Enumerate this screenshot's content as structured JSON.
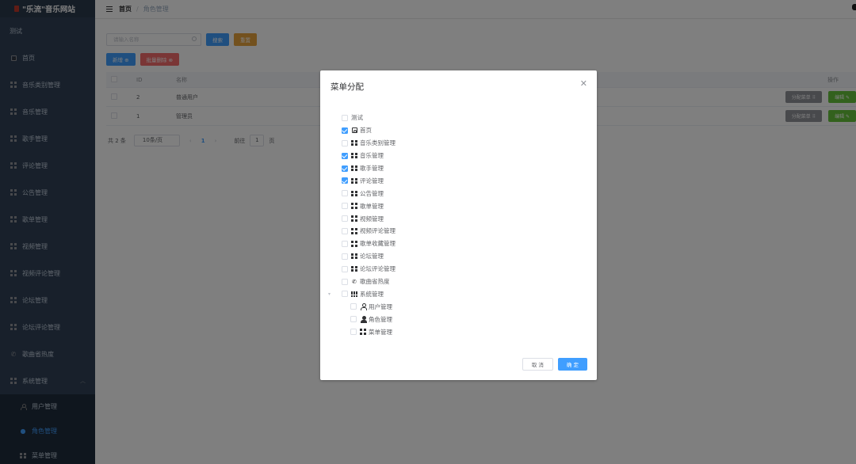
{
  "app": {
    "logo_text": "\"乐流\"音乐网站"
  },
  "sidebar": {
    "items": [
      {
        "label": "测试",
        "icon": "none"
      },
      {
        "label": "首页",
        "icon": "home-icon"
      },
      {
        "label": "音乐类别管理",
        "icon": "grid-icon"
      },
      {
        "label": "音乐管理",
        "icon": "grid-icon"
      },
      {
        "label": "歌手管理",
        "icon": "grid-icon"
      },
      {
        "label": "评论管理",
        "icon": "grid-icon"
      },
      {
        "label": "公告管理",
        "icon": "grid-icon"
      },
      {
        "label": "歌单管理",
        "icon": "grid-icon"
      },
      {
        "label": "视频管理",
        "icon": "grid-icon"
      },
      {
        "label": "视频评论管理",
        "icon": "grid-icon"
      },
      {
        "label": "论坛管理",
        "icon": "grid-icon"
      },
      {
        "label": "论坛评论管理",
        "icon": "grid-icon"
      },
      {
        "label": "歌曲省热度",
        "icon": "phone-icon"
      },
      {
        "label": "系统管理",
        "icon": "grid-icon"
      }
    ],
    "system_children": [
      {
        "label": "用户管理",
        "icon": "user-outline-icon",
        "active": false
      },
      {
        "label": "角色管理",
        "icon": "user-solid-icon",
        "active": true
      },
      {
        "label": "菜单管理",
        "icon": "grid-icon",
        "active": false
      }
    ]
  },
  "breadcrumb": {
    "home": "首页",
    "current": "角色管理"
  },
  "toolbar": {
    "search_placeholder": "请输入名称",
    "search_label": "搜索",
    "reset_label": "重置",
    "add_label": "新增 ⊕",
    "batch_delete_label": "批量删除 ⊗"
  },
  "table": {
    "headers": {
      "id": "ID",
      "name": "名称",
      "ops": "操作"
    },
    "rows": [
      {
        "id": "2",
        "name": "普通用户"
      },
      {
        "id": "1",
        "name": "管理员"
      }
    ],
    "assign_menu_label": "分配菜单 ⠿",
    "edit_label": "编辑 ✎"
  },
  "pagination": {
    "total": "共 2 条",
    "page_size": "10条/页",
    "current_page": "1",
    "goto_prefix": "前往",
    "goto_value": "1",
    "goto_suffix": "页"
  },
  "dialog": {
    "title": "菜单分配",
    "cancel_label": "取 消",
    "confirm_label": "确 定",
    "tree": [
      {
        "label": "测试",
        "checked": false,
        "icon": "none"
      },
      {
        "label": "首页",
        "checked": true,
        "icon": "home-icon"
      },
      {
        "label": "音乐类别管理",
        "checked": false,
        "icon": "grid-icon"
      },
      {
        "label": "音乐管理",
        "checked": true,
        "icon": "grid-icon"
      },
      {
        "label": "歌手管理",
        "checked": true,
        "icon": "grid-icon"
      },
      {
        "label": "评论管理",
        "checked": true,
        "icon": "grid-icon"
      },
      {
        "label": "公告管理",
        "checked": false,
        "icon": "grid-icon"
      },
      {
        "label": "歌单管理",
        "checked": false,
        "icon": "grid-icon"
      },
      {
        "label": "视频管理",
        "checked": false,
        "icon": "grid-icon"
      },
      {
        "label": "视频评论管理",
        "checked": false,
        "icon": "grid-icon"
      },
      {
        "label": "歌单收藏管理",
        "checked": false,
        "icon": "grid-icon"
      },
      {
        "label": "论坛管理",
        "checked": false,
        "icon": "grid-icon"
      },
      {
        "label": "论坛评论管理",
        "checked": false,
        "icon": "grid-icon"
      },
      {
        "label": "歌曲省热度",
        "checked": false,
        "icon": "phone-icon"
      },
      {
        "label": "系统管理",
        "checked": false,
        "icon": "grid9-icon",
        "expanded": true
      },
      {
        "label": "用户管理",
        "checked": false,
        "icon": "user-outline-icon",
        "child": true
      },
      {
        "label": "角色管理",
        "checked": false,
        "icon": "user-solid-icon",
        "child": true
      },
      {
        "label": "菜单管理",
        "checked": false,
        "icon": "grid-icon",
        "child": true
      }
    ]
  },
  "colors": {
    "primary": "#409eff",
    "sidebar_bg": "#304156",
    "warning": "#e6a23c",
    "danger": "#f56c6c",
    "success": "#67c23a"
  }
}
